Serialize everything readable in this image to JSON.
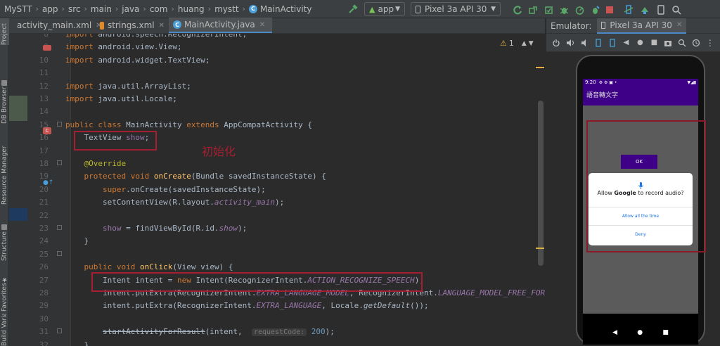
{
  "breadcrumbs": [
    "MySTT",
    "app",
    "src",
    "main",
    "java",
    "com",
    "huang",
    "mystt",
    "MainActivity"
  ],
  "toolbar": {
    "run_config": "app",
    "device": "Pixel 3a API 30"
  },
  "left_stripe": [
    "Project",
    "DB Browser",
    "Resource Manager",
    "Structure",
    "Favorites",
    "Build Variants"
  ],
  "tabs": [
    {
      "label": "activity_main.xml",
      "active": false,
      "icon_color": "#e08a2a"
    },
    {
      "label": "strings.xml",
      "active": false,
      "icon_color": "#e08a2a"
    },
    {
      "label": "MainActivity.java",
      "active": true,
      "icon_color": "#4a9fd8"
    }
  ],
  "editor": {
    "warning_count": "1",
    "annotation_text": "初始化",
    "lines": [
      {
        "n": "8",
        "raw": "import android.speech.RecognizerIntent;"
      },
      {
        "n": "9",
        "raw": "import android.view.View;"
      },
      {
        "n": "10",
        "raw": "import android.widget.TextView;"
      },
      {
        "n": "11",
        "raw": ""
      },
      {
        "n": "12",
        "raw": "import java.util.ArrayList;"
      },
      {
        "n": "13",
        "raw": "import java.util.Locale;"
      },
      {
        "n": "14",
        "raw": ""
      },
      {
        "n": "15",
        "raw": "public class MainActivity extends AppCompatActivity {"
      },
      {
        "n": "16",
        "raw": "    TextView show;"
      },
      {
        "n": "17",
        "raw": ""
      },
      {
        "n": "18",
        "raw": "    @Override"
      },
      {
        "n": "19",
        "raw": "    protected void onCreate(Bundle savedInstanceState) {"
      },
      {
        "n": "20",
        "raw": "        super.onCreate(savedInstanceState);"
      },
      {
        "n": "21",
        "raw": "        setContentView(R.layout.activity_main);"
      },
      {
        "n": "22",
        "raw": ""
      },
      {
        "n": "23",
        "raw": "        show = findViewById(R.id.show);"
      },
      {
        "n": "24",
        "raw": "    }"
      },
      {
        "n": "25",
        "raw": ""
      },
      {
        "n": "26",
        "raw": "    public void onClick(View view) {"
      },
      {
        "n": "27",
        "raw": "        Intent intent = new Intent(RecognizerIntent.ACTION_RECOGNIZE_SPEECH);"
      },
      {
        "n": "28",
        "raw": "        intent.putExtra(RecognizerIntent.EXTRA_LANGUAGE_MODEL, RecognizerIntent.LANGUAGE_MODEL_FREE_FORM);"
      },
      {
        "n": "29",
        "raw": "        intent.putExtra(RecognizerIntent.EXTRA_LANGUAGE, Locale.getDefault());"
      },
      {
        "n": "30",
        "raw": ""
      },
      {
        "n": "31",
        "raw": "        startActivityForResult(intent,  requestCode: 200);"
      },
      {
        "n": "32",
        "raw": "    }"
      }
    ]
  },
  "emulator": {
    "header_label": "Emulator:",
    "device_tab": "Pixel 3a API 30",
    "status_time": "9:20",
    "app_title": "語音轉文字",
    "button_label": "OK",
    "dialog": {
      "title_pre": "Allow ",
      "title_bold": "Google",
      "title_post": " to record audio?",
      "option_allow": "Allow all the time",
      "option_deny": "Deny"
    }
  },
  "colors": {
    "accent": "#4a88c7",
    "highlight_box": "#a51f32",
    "app_primary": "#3e0087"
  }
}
